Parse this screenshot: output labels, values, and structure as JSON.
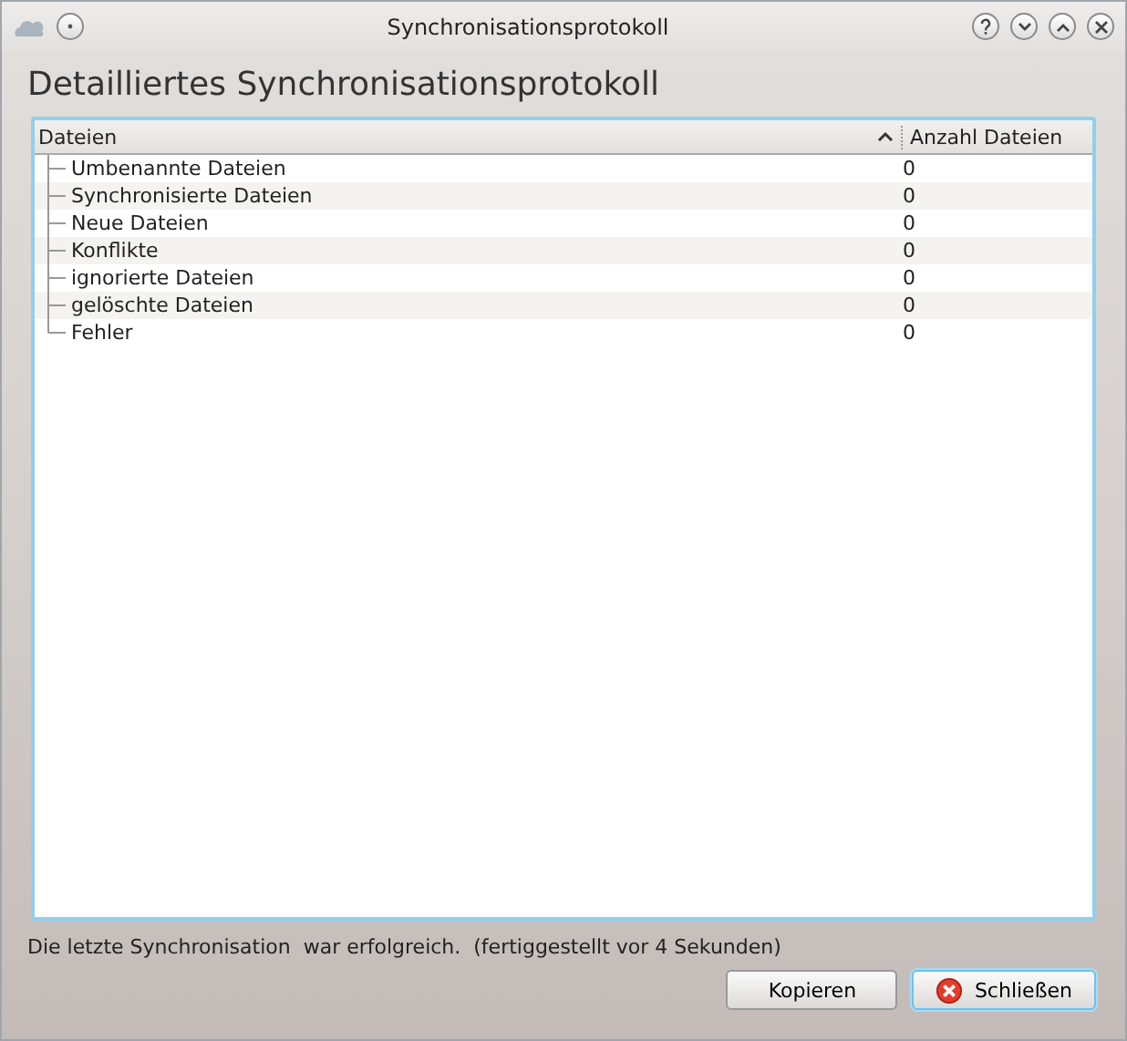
{
  "window": {
    "title": "Synchronisationsprotokoll"
  },
  "heading": "Detailliertes Synchronisationsprotokoll",
  "table": {
    "columns": [
      "Dateien",
      "Anzahl Dateien"
    ],
    "rows": [
      {
        "name": "Umbenannte Dateien",
        "count": "0"
      },
      {
        "name": "Synchronisierte Dateien",
        "count": "0"
      },
      {
        "name": "Neue Dateien",
        "count": "0"
      },
      {
        "name": "Konflikte",
        "count": "0"
      },
      {
        "name": "ignorierte Dateien",
        "count": "0"
      },
      {
        "name": "gelöschte Dateien",
        "count": "0"
      },
      {
        "name": "Fehler",
        "count": "0"
      }
    ]
  },
  "status": "Die letzte Synchronisation  war erfolgreich.  (fertiggestellt vor 4 Sekunden)",
  "buttons": [
    {
      "label": "Kopieren",
      "kind": "plain",
      "focused": false
    },
    {
      "label": "Schließen",
      "kind": "close",
      "focused": true
    }
  ]
}
